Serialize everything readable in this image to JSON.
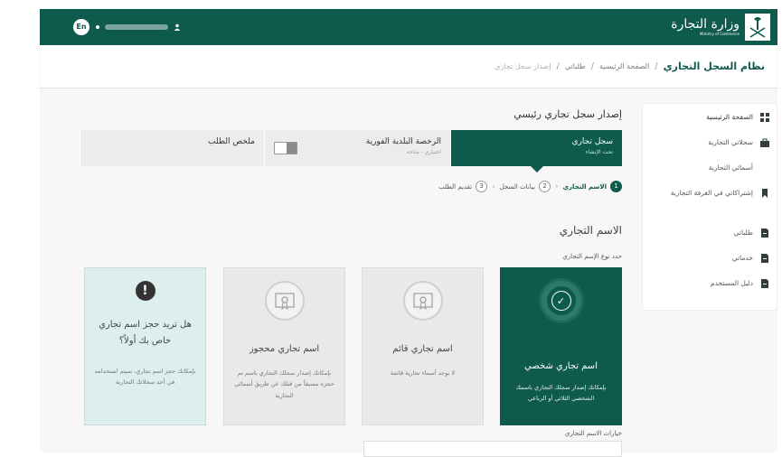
{
  "header": {
    "lang": "En",
    "ministry_ar": "وزارة التجارة",
    "ministry_en": "Ministry of Commerce"
  },
  "breadcrumb": {
    "system": "نظام السجل التجاري",
    "items": [
      "الصفحة الرئيسية",
      "طلباتي",
      "إصدار سجل تجاري"
    ]
  },
  "sidebar": {
    "items": [
      {
        "label": "الصفحة الرئيسية",
        "icon": "grid-icon"
      },
      {
        "label": "سجلاتي التجارية",
        "icon": "briefcase-icon"
      },
      {
        "label": "أسمائي التجارية",
        "icon": "tn-icon"
      },
      {
        "label": "إشتراكاتي في الغرفة التجارية",
        "icon": "bookmark-icon"
      },
      {
        "label": "طلباتي",
        "icon": "document-icon"
      },
      {
        "label": "خدماتي",
        "icon": "document-icon"
      },
      {
        "label": "دليل المستخدم",
        "icon": "document-icon"
      }
    ]
  },
  "main": {
    "title": "إصدار سجل تجاري رئيسي",
    "tabs": [
      {
        "title": "سجل تجاري",
        "subtitle": "تحت الإنشاء"
      },
      {
        "title": "الرخصة البلدية الفورية",
        "subtitle": "اختياري - متاحة"
      },
      {
        "title": "ملخص الطلب",
        "subtitle": ""
      }
    ],
    "steps": [
      {
        "num": "1",
        "label": "الاسم التجاري"
      },
      {
        "num": "2",
        "label": "بيانات السجل"
      },
      {
        "num": "3",
        "label": "تقديم الطلب"
      }
    ],
    "section_title": "الاسم التجاري",
    "type_label": "حدد نوع الإسم التجاري",
    "cards": [
      {
        "title": "اسم تجاري شخصي",
        "desc": "بإمكانك إصدار سجلك التجاري باسمك الشخصي الثلاثي أو الرباعي"
      },
      {
        "title": "اسم تجاري قائم",
        "desc": "لا يوجد أسماء تجارية قائمة"
      },
      {
        "title": "اسم تجاري محجوز",
        "desc": "بإمكانك إصدار سجلك التجاري باسم تم حجزه مسبقاً من قبلك عن طريق أسمائي التجارية"
      },
      {
        "title": "هل تريد حجز اسم تجاري خاص بك أولاً؟",
        "desc": "بإمكانك حجز اسم تجاري، سيتم استخدامه في أحد سجلاتك التجارية"
      }
    ],
    "options_label": "خيارات الاسم التجاري"
  },
  "colors": {
    "brand": "#0e5a4c",
    "info_card": "#dceeed"
  }
}
